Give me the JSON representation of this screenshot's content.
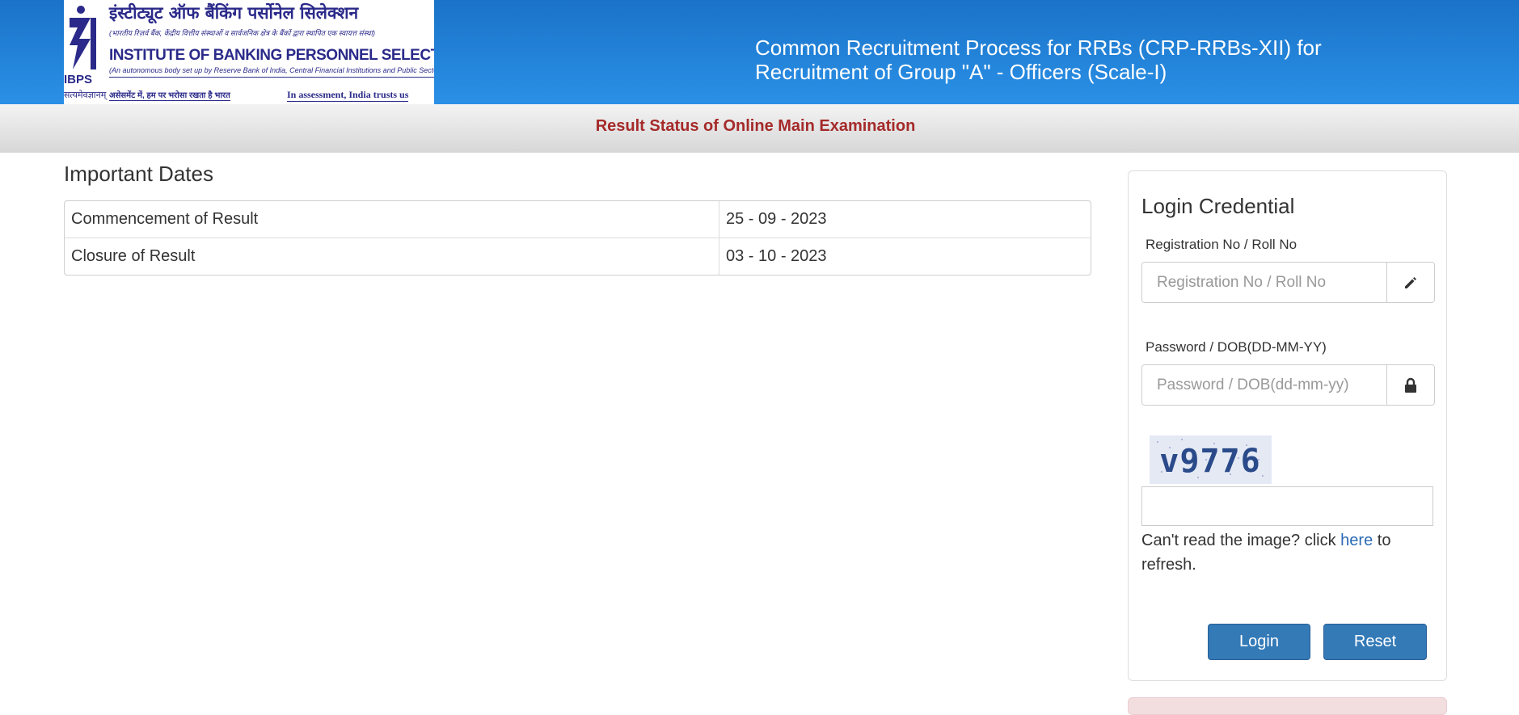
{
  "header": {
    "logo": {
      "mark_text": "IBPS",
      "mark_sub": "सत्यमेवज्ञानम्",
      "hindi_name": "इंस्टीट्यूट ऑफ बैंकिंग पर्सोनेल सिलेक्शन",
      "hindi_sub": "(भारतीय रिज़र्व बैंक, केंद्रीय वित्तीय संस्थाओं व सार्वजनिक क्षेत्र के बैंकों द्वारा स्थापित एक स्वायत्त संस्था)",
      "english_name": "INSTITUTE OF BANKING PERSONNEL SELECTION",
      "english_sub": "(An autonomous body set up by Reserve Bank of India, Central Financial Institutions and Public Sector Banks)",
      "tagline_hindi": "असेसमेंट में, हम पर भरोसा रखता है भारत",
      "tagline_english": "In assessment, India trusts us"
    },
    "title": "Common Recruitment Process for RRBs (CRP-RRBs-XII) for Recruitment of Group \"A\" - Officers (Scale-I)"
  },
  "subbar": {
    "title": "Result Status of Online Main Examination"
  },
  "important_dates": {
    "title": "Important Dates",
    "rows": [
      {
        "label": "Commencement of Result",
        "value": "25 - 09 - 2023"
      },
      {
        "label": "Closure of Result",
        "value": "03 - 10 - 2023"
      }
    ]
  },
  "login": {
    "title": "Login Credential",
    "registration_label": "Registration No / Roll No",
    "registration_placeholder": "Registration No / Roll No",
    "password_label": "Password / DOB(DD-MM-YY)",
    "password_placeholder": "Password / DOB(dd-mm-yy)",
    "captcha_text": "v9776",
    "refresh_prefix": "Can't read the image? click ",
    "refresh_link": "here",
    "refresh_suffix": " to refresh.",
    "login_label": "Login",
    "reset_label": "Reset",
    "icons": {
      "registration": "pencil-icon",
      "password": "lock-icon"
    }
  },
  "colors": {
    "header_blue": "#1a73c8",
    "subbar_title": "#a52a2a",
    "button_blue": "#337ab7",
    "link_blue": "#2c6bb6"
  }
}
